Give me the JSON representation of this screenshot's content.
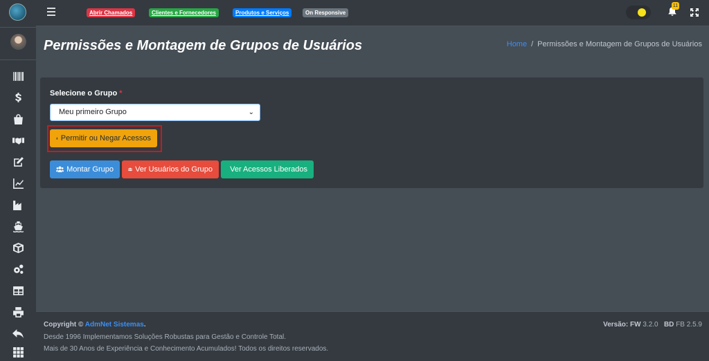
{
  "topbar": {
    "chips": [
      {
        "label": "Abrir Chamados",
        "color": "#dc3545"
      },
      {
        "label": "Clientes e Fornecedores",
        "color": "#28a745"
      },
      {
        "label": "Produtos e Serviços",
        "color": "#007bff"
      },
      {
        "label": "On Responsive",
        "color": "#6c757d"
      }
    ],
    "notification_count": "11"
  },
  "sidebar": {
    "icons": [
      "barcode-icon",
      "dollar-icon",
      "shopping-bag-icon",
      "handshake-icon",
      "edit-icon",
      "line-chart-icon",
      "industry-icon",
      "ship-icon",
      "box-icon",
      "cogs-icon",
      "table-icon",
      "print-icon",
      "reply-icon",
      "grid-icon"
    ]
  },
  "header": {
    "title": "Permissões e Montagem de Grupos de Usuários",
    "breadcrumb": {
      "home": "Home",
      "separator": "/",
      "current": "Permissões e Montagem de Grupos de Usuários"
    }
  },
  "form": {
    "group_label": "Selecione o Grupo",
    "required_mark": "*",
    "selected_group": "Meu primeiro Grupo"
  },
  "buttons": {
    "permit": "Permitir ou Negar Acessos",
    "build_group": "Montar Grupo",
    "view_users": "Ver Usuários do Grupo",
    "view_access": "Ver Acessos Liberados"
  },
  "footer": {
    "copyright_prefix": "Copyright ©",
    "brand": "AdmNet Sistemas",
    "period": ".",
    "line1": "Desde 1996 Implementamos Soluções Robustas para Gestão e Controle Total.",
    "line2": "Mais de 30 Anos de Experiência e Conhecimento Acumulados! Todos os direitos reservados.",
    "version_label": "Versão: FW",
    "version_value": "3.2.0",
    "bd_label": "BD",
    "bd_value": "FB 2.5.9"
  },
  "colors": {
    "accent": "#3d8ff4",
    "warning": "#f0a30a",
    "highlight": "#d01818"
  }
}
